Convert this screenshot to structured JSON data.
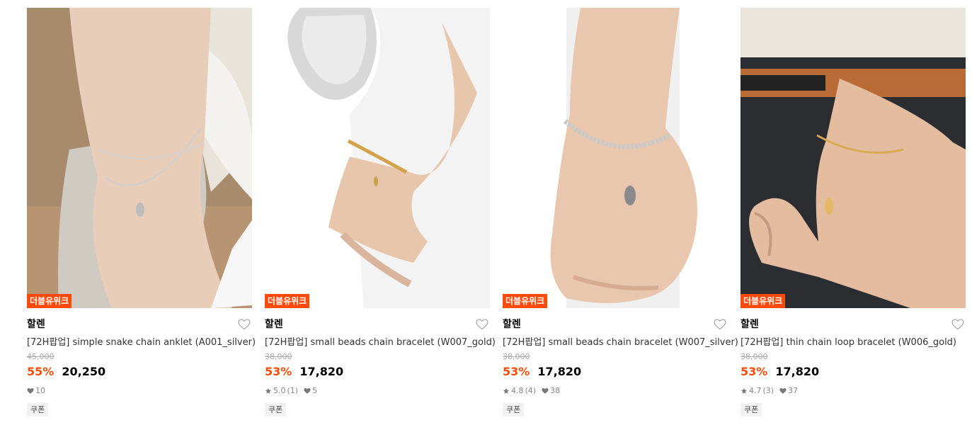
{
  "colors": {
    "accent": "#ff4a0a",
    "muted": "#888888",
    "strike": "#aaaaaa",
    "tag_bg": "#f2f2f2"
  },
  "products": [
    {
      "badge": "더블유위크",
      "brand": "할렌",
      "name": "[72H팝업] simple snake chain anklet (A001_silver)",
      "original_price": "45,000",
      "discount": "55%",
      "price": "20,250",
      "rating": "",
      "reviews": "",
      "likes": "10",
      "tag": "쿠폰",
      "image": {
        "subject": "ankle-silver-anklet",
        "icon": "heart-icon"
      }
    },
    {
      "badge": "더블유위크",
      "brand": "할렌",
      "name": "[72H팝업] small beads chain bracelet (W007_gold)",
      "original_price": "38,000",
      "discount": "53%",
      "price": "17,820",
      "rating": "5.0",
      "reviews": "(1)",
      "likes": "5",
      "tag": "쿠폰",
      "image": {
        "subject": "wrist-gold-bracelet-white-dress",
        "icon": "heart-icon"
      }
    },
    {
      "badge": "더블유위크",
      "brand": "할렌",
      "name": "[72H팝업] small beads chain bracelet (W007_silver)",
      "original_price": "38,000",
      "discount": "53%",
      "price": "17,820",
      "rating": "4.8",
      "reviews": "(4)",
      "likes": "38",
      "tag": "쿠폰",
      "image": {
        "subject": "wrist-silver-bracelet",
        "icon": "heart-icon"
      }
    },
    {
      "badge": "더블유위크",
      "brand": "할렌",
      "name": "[72H팝업] thin chain loop bracelet (W006_gold)",
      "original_price": "38,000",
      "discount": "53%",
      "price": "17,820",
      "rating": "4.7",
      "reviews": "(3)",
      "likes": "37",
      "tag": "쿠폰",
      "image": {
        "subject": "wrist-gold-bracelet-jeans",
        "icon": "heart-icon"
      }
    }
  ]
}
